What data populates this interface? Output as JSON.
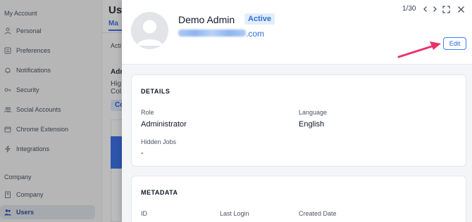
{
  "sidebar": {
    "section_account": "My Account",
    "items": [
      {
        "label": "Personal",
        "icon": "person-icon"
      },
      {
        "label": "Preferences",
        "icon": "preferences-icon"
      },
      {
        "label": "Notifications",
        "icon": "bell-icon"
      },
      {
        "label": "Security",
        "icon": "key-icon"
      },
      {
        "label": "Social Accounts",
        "icon": "people-icon"
      },
      {
        "label": "Chrome Extension",
        "icon": "extension-icon"
      },
      {
        "label": "Integrations",
        "icon": "integrations-icon"
      }
    ],
    "section_company": "Company",
    "company_items": [
      {
        "label": "Company",
        "icon": "building-icon"
      },
      {
        "label": "Users",
        "icon": "users-icon"
      }
    ]
  },
  "background": {
    "title": "Use",
    "tab": "Ma",
    "acti": "Acti",
    "adm": "Adm",
    "hig": "Hig",
    "col": "Col",
    "chip": "Co"
  },
  "drawer": {
    "name": "Demo Admin",
    "status": "Active",
    "email_visible": ".com",
    "pager": "1/30",
    "edit_label": "Edit",
    "details": {
      "title": "DETAILS",
      "role_label": "Role",
      "role_value": "Administrator",
      "language_label": "Language",
      "language_value": "English",
      "hidden_jobs_label": "Hidden Jobs",
      "hidden_jobs_value": "-"
    },
    "metadata": {
      "title": "METADATA",
      "id_label": "ID",
      "last_login_label": "Last Login",
      "created_label": "Created Date"
    }
  },
  "colors": {
    "accent": "#2563eb",
    "arrow": "#e8336b",
    "badge_bg": "#e3eefc"
  }
}
